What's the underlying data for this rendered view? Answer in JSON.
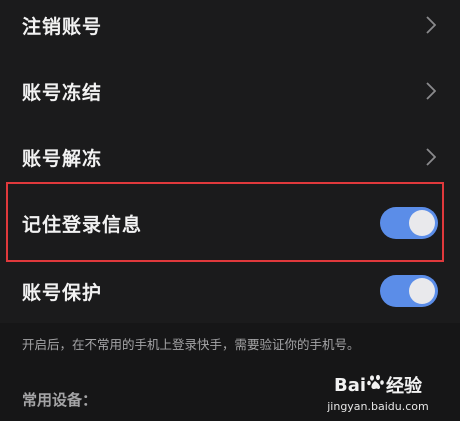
{
  "settings": {
    "rows": [
      {
        "label": "注销账号",
        "control": "chevron"
      },
      {
        "label": "账号冻结",
        "control": "chevron"
      },
      {
        "label": "账号解冻",
        "control": "chevron"
      },
      {
        "label": "记住登录信息",
        "control": "toggle",
        "on": true
      },
      {
        "label": "账号保护",
        "control": "toggle",
        "on": true
      }
    ],
    "hint": "开启后，在不常用的手机上登录快手，需要验证你的手机号。",
    "common_devices_title": "常用设备："
  },
  "watermark": {
    "brand_left": "Bai",
    "brand_right": "经验",
    "url": "jingyan.baidu.com"
  },
  "colors": {
    "background": "#1b1b1c",
    "toggle_on": "#5b8de8",
    "highlight_border": "#e0393c"
  }
}
